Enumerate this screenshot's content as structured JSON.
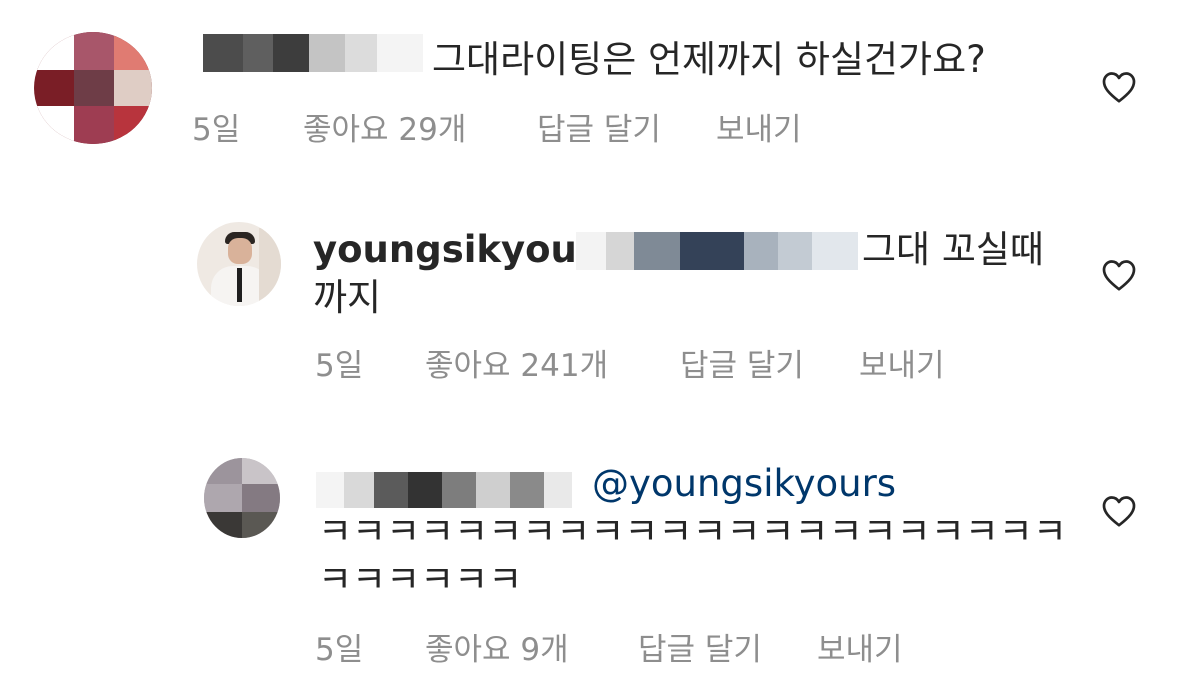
{
  "comments": [
    {
      "username_visible": "",
      "text": "그대라이팅은 언제까지 하실건가요?",
      "time": "5일",
      "likes": "좋아요 29개",
      "reply": "답글 달기",
      "send": "보내기",
      "like_icon": "heart-outline-icon"
    },
    {
      "username_visible": "youngsikyours",
      "text_line1": "그대 꼬실때",
      "text_line2": "까지",
      "time": "5일",
      "likes": "좋아요 241개",
      "reply": "답글 달기",
      "send": "보내기",
      "like_icon": "heart-outline-icon"
    },
    {
      "mention": "@youngsikyours",
      "text_line1": "ㅋㅋㅋㅋㅋㅋㅋㅋㅋㅋㅋㅋㅋㅋㅋㅋㅋㅋㅋㅋㅋㅋ",
      "text_line2": "ㅋㅋㅋㅋㅋㅋ",
      "time": "5일",
      "likes": "좋아요 9개",
      "reply": "답글 달기",
      "send": "보내기",
      "like_icon": "heart-outline-icon"
    }
  ],
  "colors": {
    "text": "#262626",
    "meta": "#8e8e8e",
    "mention": "#00376b",
    "background": "#ffffff"
  }
}
